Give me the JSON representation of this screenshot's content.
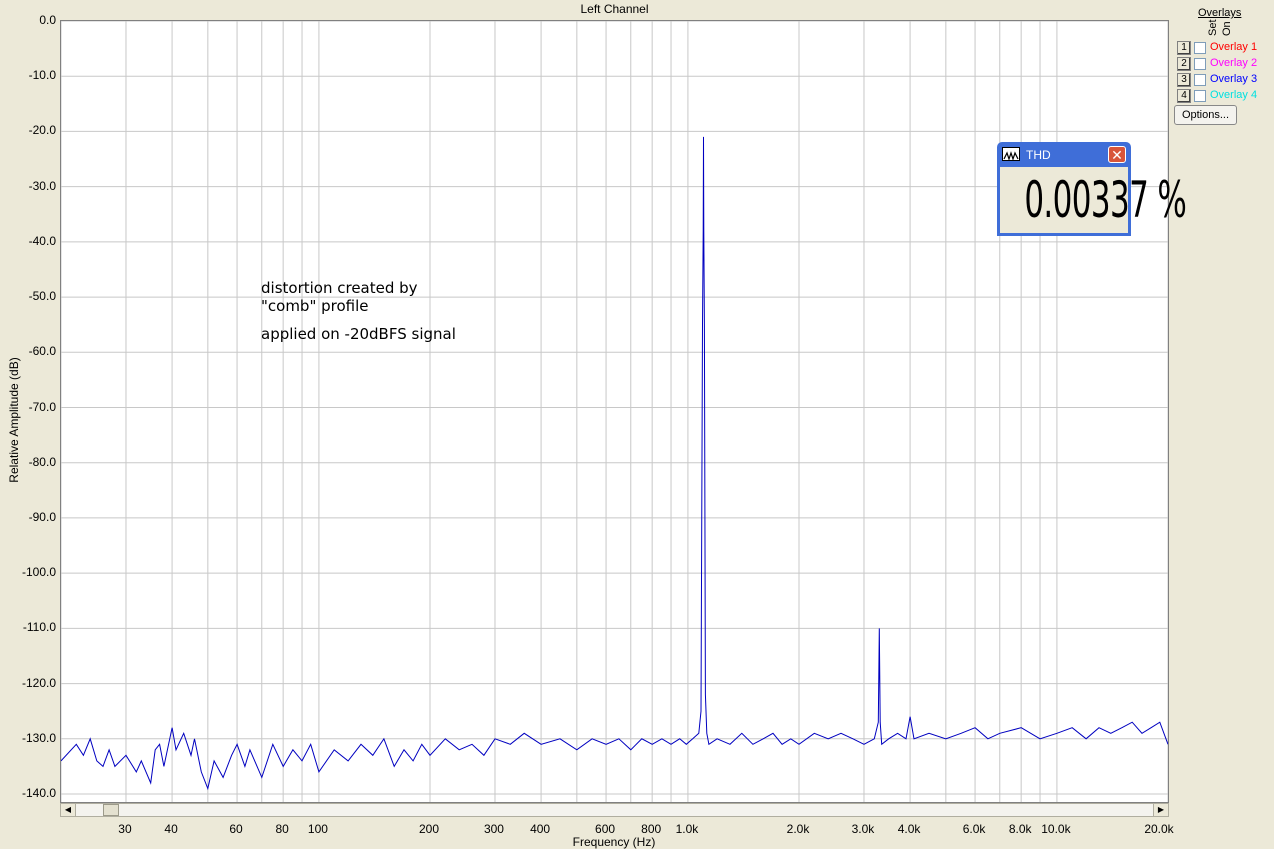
{
  "chart_data": {
    "type": "line",
    "title": "Left Channel",
    "xlabel": "Frequency (Hz)",
    "ylabel": "Relative Amplitude (dB)",
    "x_scale": "log",
    "xlim": [
      20,
      20000
    ],
    "ylim": [
      -140,
      0
    ],
    "grid": true,
    "y_ticks": [
      "0.0",
      "-10.0",
      "-20.0",
      "-30.0",
      "-40.0",
      "-50.0",
      "-60.0",
      "-70.0",
      "-80.0",
      "-90.0",
      "-100.0",
      "-110.0",
      "-120.0",
      "-130.0",
      "-140.0"
    ],
    "x_ticks": [
      {
        "v": 30,
        "label": "30"
      },
      {
        "v": 40,
        "label": "40"
      },
      {
        "v": 60,
        "label": "60"
      },
      {
        "v": 80,
        "label": "80"
      },
      {
        "v": 100,
        "label": "100"
      },
      {
        "v": 200,
        "label": "200"
      },
      {
        "v": 300,
        "label": "300"
      },
      {
        "v": 400,
        "label": "400"
      },
      {
        "v": 600,
        "label": "600"
      },
      {
        "v": 800,
        "label": "800"
      },
      {
        "v": 1000,
        "label": "1.0k"
      },
      {
        "v": 2000,
        "label": "2.0k"
      },
      {
        "v": 3000,
        "label": "3.0k"
      },
      {
        "v": 4000,
        "label": "4.0k"
      },
      {
        "v": 6000,
        "label": "6.0k"
      },
      {
        "v": 8000,
        "label": "8.0k"
      },
      {
        "v": 10000,
        "label": "10.0k"
      },
      {
        "v": 20000,
        "label": "20.0k"
      }
    ],
    "series": [
      {
        "color": "#0000c0",
        "points": [
          [
            20,
            -134
          ],
          [
            22,
            -131
          ],
          [
            23,
            -133
          ],
          [
            24,
            -130
          ],
          [
            25,
            -134
          ],
          [
            26,
            -135
          ],
          [
            27,
            -132
          ],
          [
            28,
            -135
          ],
          [
            30,
            -133
          ],
          [
            32,
            -136
          ],
          [
            33,
            -134
          ],
          [
            35,
            -138
          ],
          [
            36,
            -132
          ],
          [
            37,
            -131
          ],
          [
            38,
            -135
          ],
          [
            40,
            -128
          ],
          [
            41,
            -132
          ],
          [
            43,
            -129
          ],
          [
            45,
            -133
          ],
          [
            46,
            -130
          ],
          [
            48,
            -136
          ],
          [
            50,
            -139
          ],
          [
            52,
            -134
          ],
          [
            55,
            -137
          ],
          [
            58,
            -133
          ],
          [
            60,
            -131
          ],
          [
            63,
            -135
          ],
          [
            65,
            -132
          ],
          [
            70,
            -137
          ],
          [
            75,
            -131
          ],
          [
            80,
            -135
          ],
          [
            85,
            -132
          ],
          [
            90,
            -134
          ],
          [
            95,
            -131
          ],
          [
            100,
            -136
          ],
          [
            110,
            -132
          ],
          [
            120,
            -134
          ],
          [
            130,
            -131
          ],
          [
            140,
            -133
          ],
          [
            150,
            -130
          ],
          [
            160,
            -135
          ],
          [
            170,
            -132
          ],
          [
            180,
            -134
          ],
          [
            190,
            -131
          ],
          [
            200,
            -133
          ],
          [
            220,
            -130
          ],
          [
            240,
            -132
          ],
          [
            260,
            -131
          ],
          [
            280,
            -133
          ],
          [
            300,
            -130
          ],
          [
            330,
            -131
          ],
          [
            360,
            -129
          ],
          [
            400,
            -131
          ],
          [
            450,
            -130
          ],
          [
            500,
            -132
          ],
          [
            550,
            -130
          ],
          [
            600,
            -131
          ],
          [
            650,
            -130
          ],
          [
            700,
            -132
          ],
          [
            750,
            -130
          ],
          [
            800,
            -131
          ],
          [
            850,
            -130
          ],
          [
            900,
            -131
          ],
          [
            950,
            -130
          ],
          [
            990,
            -131
          ],
          [
            1030,
            -130
          ],
          [
            1070,
            -129
          ],
          [
            1085,
            -125
          ],
          [
            1095,
            -55
          ],
          [
            1100,
            -38
          ],
          [
            1102,
            -21
          ],
          [
            1104,
            -38
          ],
          [
            1108,
            -55
          ],
          [
            1115,
            -122
          ],
          [
            1125,
            -129
          ],
          [
            1140,
            -131
          ],
          [
            1200,
            -130
          ],
          [
            1300,
            -131
          ],
          [
            1400,
            -129
          ],
          [
            1500,
            -131
          ],
          [
            1600,
            -130
          ],
          [
            1700,
            -129
          ],
          [
            1800,
            -131
          ],
          [
            1900,
            -130
          ],
          [
            2000,
            -131
          ],
          [
            2200,
            -129
          ],
          [
            2400,
            -130
          ],
          [
            2600,
            -129
          ],
          [
            2800,
            -130
          ],
          [
            3000,
            -131
          ],
          [
            3200,
            -130
          ],
          [
            3280,
            -127
          ],
          [
            3300,
            -110
          ],
          [
            3320,
            -127
          ],
          [
            3350,
            -131
          ],
          [
            3500,
            -130
          ],
          [
            3700,
            -129
          ],
          [
            3900,
            -130
          ],
          [
            4000,
            -126
          ],
          [
            4100,
            -130
          ],
          [
            4500,
            -129
          ],
          [
            5000,
            -130
          ],
          [
            5500,
            -129
          ],
          [
            6000,
            -128
          ],
          [
            6500,
            -130
          ],
          [
            7000,
            -129
          ],
          [
            8000,
            -128
          ],
          [
            9000,
            -130
          ],
          [
            10000,
            -129
          ],
          [
            11000,
            -128
          ],
          [
            12000,
            -130
          ],
          [
            13000,
            -128
          ],
          [
            14000,
            -129
          ],
          [
            15000,
            -128
          ],
          [
            16000,
            -127
          ],
          [
            17000,
            -129
          ],
          [
            18000,
            -128
          ],
          [
            19000,
            -127
          ],
          [
            20000,
            -131
          ]
        ]
      }
    ],
    "annotations": [
      "distortion created by",
      "\"comb\" profile",
      "applied on -20dBFS signal"
    ]
  },
  "thd": {
    "title": "THD",
    "value": "0.00337 %"
  },
  "overlays": {
    "title": "Overlays",
    "set_label": "Set",
    "on_label": "On",
    "items": [
      {
        "num": "1",
        "label": "Overlay 1",
        "color": "#ff0000"
      },
      {
        "num": "2",
        "label": "Overlay 2",
        "color": "#ff00ff"
      },
      {
        "num": "3",
        "label": "Overlay 3",
        "color": "#0000ff"
      },
      {
        "num": "4",
        "label": "Overlay 4",
        "color": "#00e0e0"
      }
    ],
    "options_label": "Options..."
  }
}
